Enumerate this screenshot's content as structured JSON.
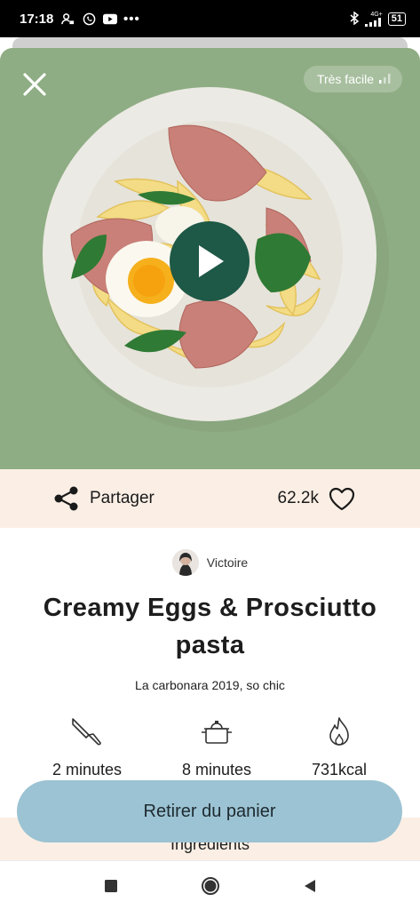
{
  "status_bar": {
    "time": "17:18",
    "network": "4G+",
    "battery": "51",
    "icons": [
      "lock-person-icon",
      "whatsapp-icon",
      "youtube-icon",
      "more-icon",
      "bluetooth-icon",
      "signal-icon"
    ]
  },
  "hero": {
    "difficulty": "Très facile",
    "background": "#8fad84",
    "play_color": "#1e5846"
  },
  "actions": {
    "share_label": "Partager",
    "likes": "62.2k"
  },
  "author": {
    "name": "Victoire"
  },
  "recipe": {
    "title": "Creamy Eggs & Prosciutto pasta",
    "subtitle": "La carbonara 2019, so chic"
  },
  "stats": [
    {
      "icon": "knife-icon",
      "value": "2 minutes"
    },
    {
      "icon": "pot-icon",
      "value": "8 minutes"
    },
    {
      "icon": "flame-icon",
      "value": "731kcal"
    }
  ],
  "ingredients": {
    "title": "Ingrédients"
  },
  "cart_button": {
    "label": "Retirer du panier",
    "color": "#9cc3d3"
  },
  "colors": {
    "accent_cream": "#fbefe5"
  }
}
